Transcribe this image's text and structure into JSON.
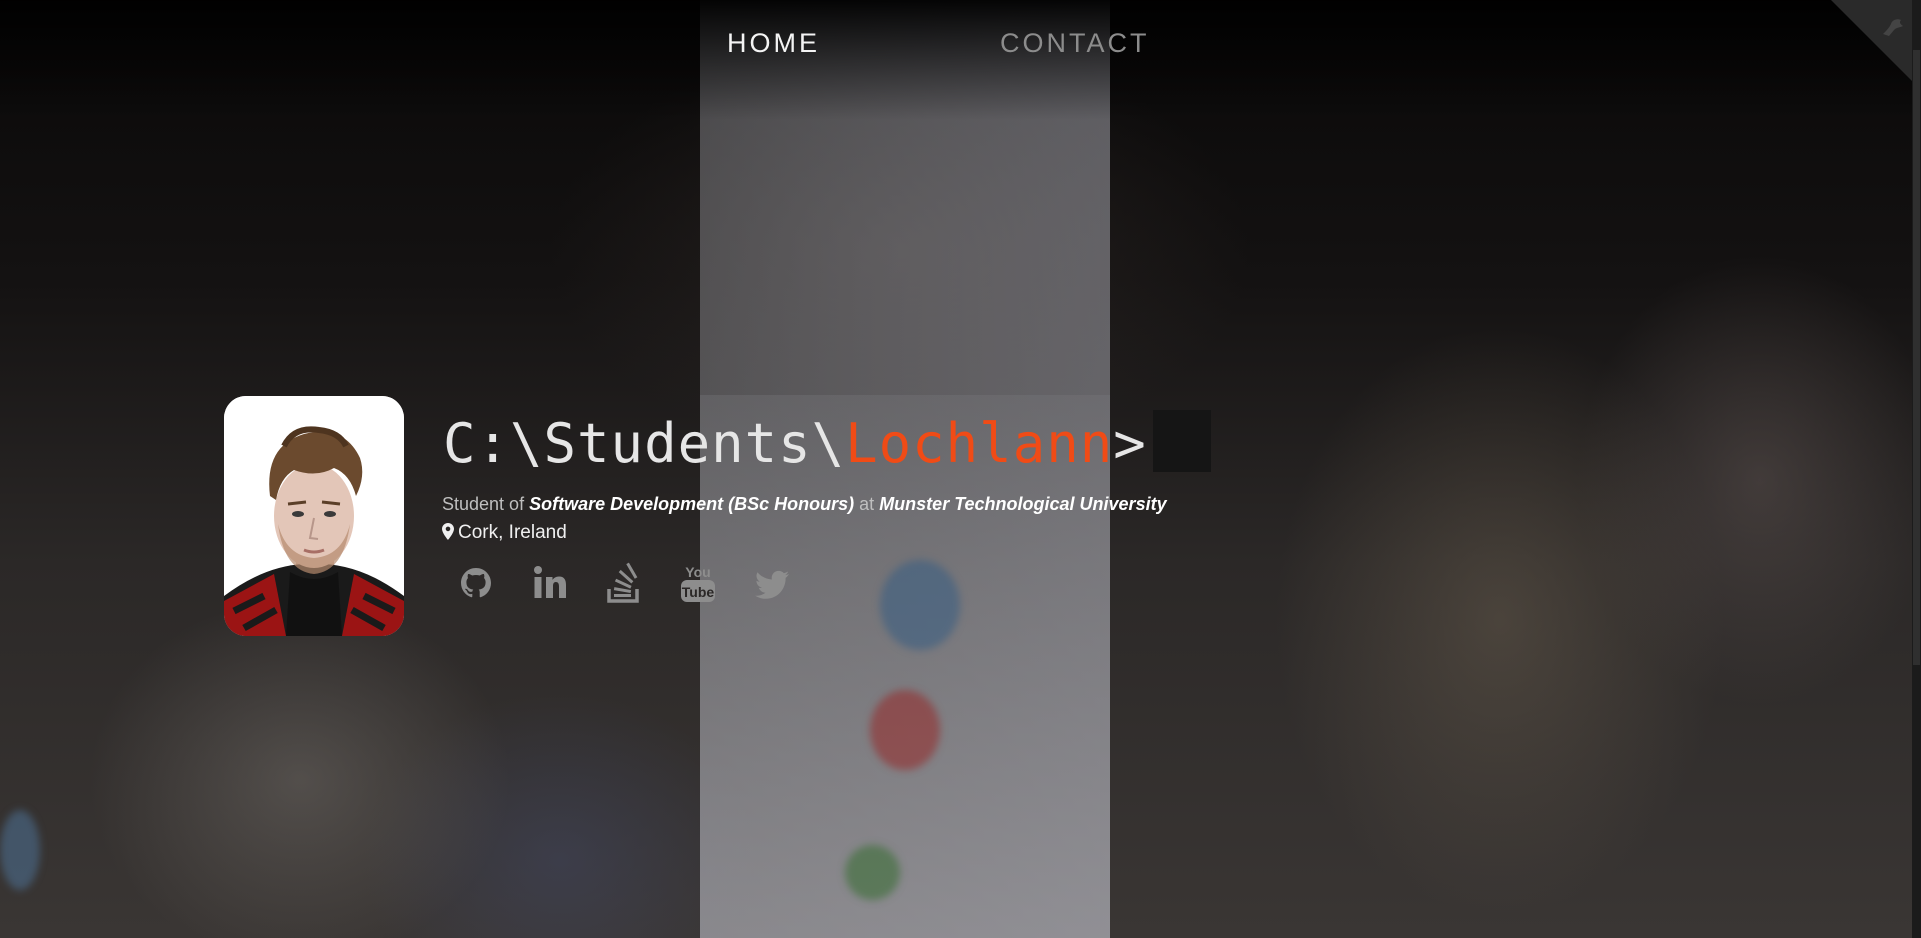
{
  "nav": {
    "items": [
      {
        "label": "HOME",
        "active": true
      },
      {
        "label": "CONTACT",
        "active": false
      }
    ]
  },
  "hero": {
    "prompt_prefix": "C:\\Students\\",
    "prompt_name": "Lochlann",
    "prompt_suffix": ">",
    "subtitle_pre": "Student of",
    "course": "Software Development (BSc Honours)",
    "subtitle_mid": "at",
    "institution": "Munster Technological University",
    "location": "Cork, Ireland"
  },
  "socials": [
    {
      "icon": "github-icon"
    },
    {
      "icon": "linkedin-icon"
    },
    {
      "icon": "stackoverflow-icon"
    },
    {
      "icon": "youtube-icon",
      "text": [
        "You",
        "Tube"
      ]
    },
    {
      "icon": "twitter-icon"
    }
  ],
  "colors": {
    "accent": "#f04b16",
    "nav_active": "#f4f4f4",
    "nav_inactive": "#8c8c8c",
    "social_icon": "#8d8d8d"
  }
}
